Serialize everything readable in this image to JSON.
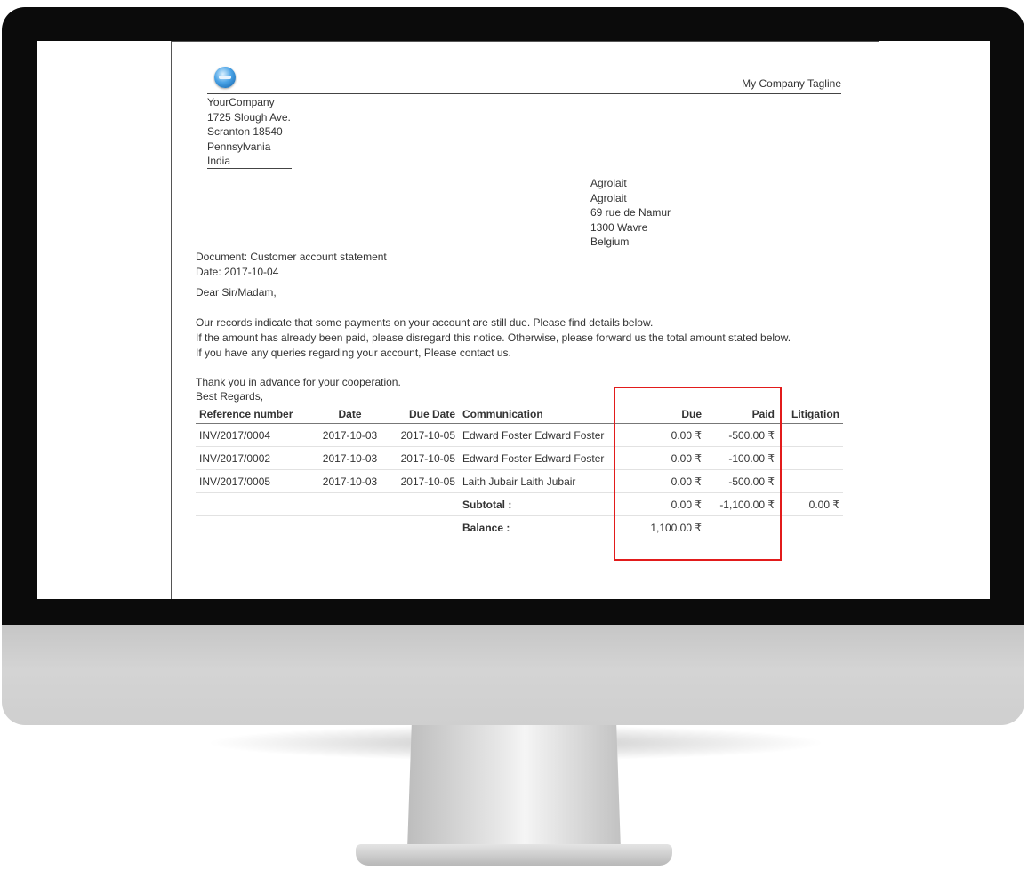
{
  "header": {
    "tagline": "My Company Tagline"
  },
  "company": {
    "lines": [
      "YourCompany",
      "1725 Slough Ave.",
      "Scranton 18540",
      "Pennsylvania",
      "India"
    ]
  },
  "partner": {
    "lines": [
      "Agrolait",
      "Agrolait",
      "69 rue de Namur",
      "1300 Wavre",
      "Belgium"
    ]
  },
  "document": {
    "doc_line": "Document: Customer account statement",
    "date_line": "Date: 2017-10-04",
    "greeting": "Dear Sir/Madam,",
    "body": [
      "Our records indicate that some payments on your account are still due. Please find details below.",
      "If the amount has already been paid, please disregard this notice. Otherwise, please forward us the total amount stated below.",
      "If you have any queries regarding your account, Please contact us."
    ],
    "thanks": "Thank you in advance for your cooperation.",
    "regards": "Best Regards,"
  },
  "table": {
    "headers": [
      "Reference number",
      "Date",
      "Due Date",
      "Communication",
      "Due",
      "Paid",
      "Litigation"
    ],
    "rows": [
      {
        "ref": "INV/2017/0004",
        "date": "2017-10-03",
        "due_date": "2017-10-05",
        "comm": "Edward Foster Edward Foster",
        "due": "0.00 ₹",
        "paid": "-500.00 ₹",
        "litigation": ""
      },
      {
        "ref": "INV/2017/0002",
        "date": "2017-10-03",
        "due_date": "2017-10-05",
        "comm": "Edward Foster Edward Foster",
        "due": "0.00 ₹",
        "paid": "-100.00 ₹",
        "litigation": ""
      },
      {
        "ref": "INV/2017/0005",
        "date": "2017-10-03",
        "due_date": "2017-10-05",
        "comm": "Laith Jubair Laith Jubair",
        "due": "0.00 ₹",
        "paid": "-500.00 ₹",
        "litigation": ""
      }
    ],
    "subtotal": {
      "label": "Subtotal :",
      "due": "0.00 ₹",
      "paid": "-1,100.00 ₹",
      "litigation": "0.00 ₹"
    },
    "balance": {
      "label": "Balance :",
      "due": "1,100.00 ₹"
    }
  },
  "colors": {
    "highlight": "#e21b1b",
    "bezel": "#0b0b0b"
  },
  "icons": {
    "logo": "company-logo-icon"
  }
}
